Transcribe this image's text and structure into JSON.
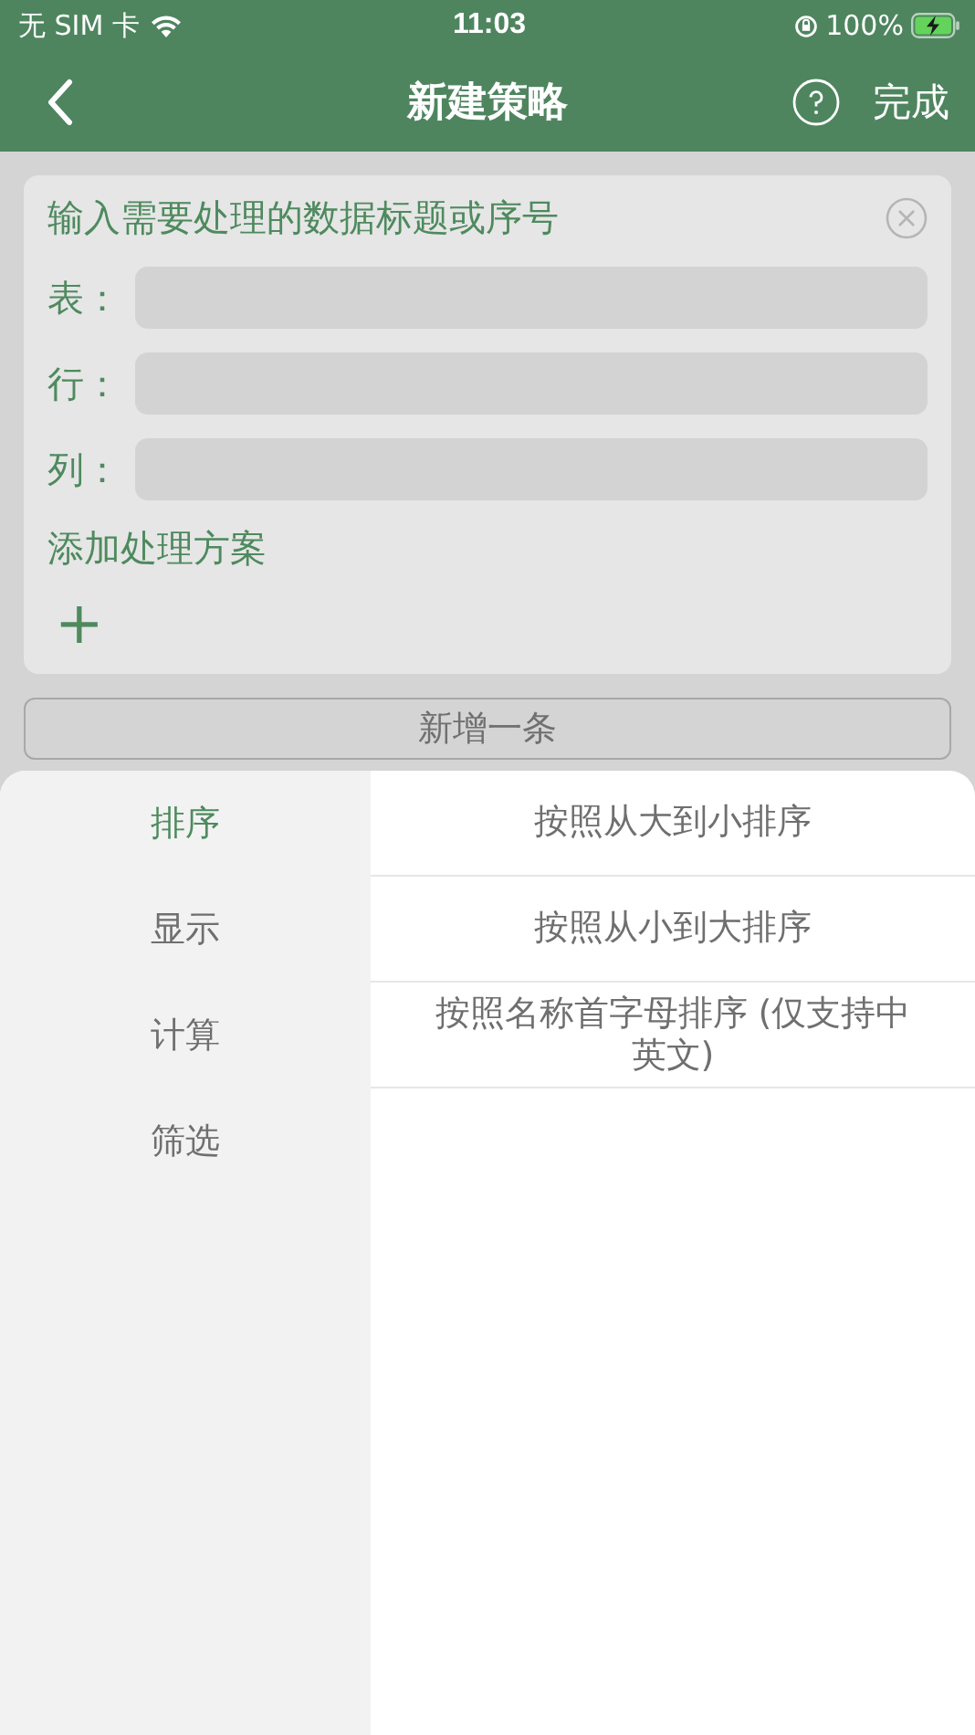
{
  "status_bar": {
    "carrier": "无 SIM 卡",
    "time": "11:03",
    "battery": "100%"
  },
  "nav": {
    "title": "新建策略",
    "done": "完成"
  },
  "card": {
    "heading": "输入需要处理的数据标题或序号",
    "fields": [
      {
        "label": "表："
      },
      {
        "label": "行："
      },
      {
        "label": "列："
      }
    ],
    "add_label": "添加处理方案",
    "add_icon": "+"
  },
  "add_button": "新增一条",
  "sheet": {
    "categories": [
      {
        "label": "排序",
        "selected": true
      },
      {
        "label": "显示",
        "selected": false
      },
      {
        "label": "计算",
        "selected": false
      },
      {
        "label": "筛选",
        "selected": false
      }
    ],
    "options": [
      "按照从大到小排序",
      "按照从小到大排序",
      "按照名称首字母排序 (仅支持中英文)"
    ]
  }
}
